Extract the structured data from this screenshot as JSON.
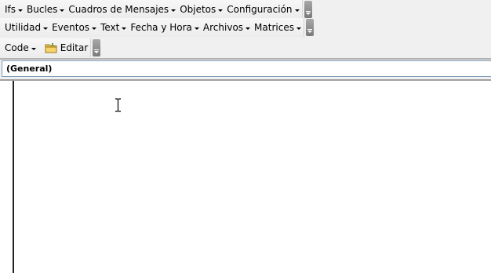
{
  "toolbar1": {
    "items": [
      {
        "label": "Ifs"
      },
      {
        "label": "Bucles"
      },
      {
        "label": "Cuadros de Mensajes"
      },
      {
        "label": "Objetos"
      },
      {
        "label": "Configuración"
      }
    ]
  },
  "toolbar2": {
    "items": [
      {
        "label": "Utilidad"
      },
      {
        "label": "Eventos"
      },
      {
        "label": "Text"
      },
      {
        "label": "Fecha y Hora"
      },
      {
        "label": "Archivos"
      },
      {
        "label": "Matrices"
      }
    ]
  },
  "toolbar3": {
    "code_label": "Code",
    "edit_label": "Editar",
    "edit_icon": "folder-icon"
  },
  "object_combo": {
    "value": "(General)"
  },
  "colors": {
    "toolbar_bg": "#f0f0f0",
    "editor_bg": "#ffffff",
    "overflow_grip": "#8a8a8a"
  }
}
